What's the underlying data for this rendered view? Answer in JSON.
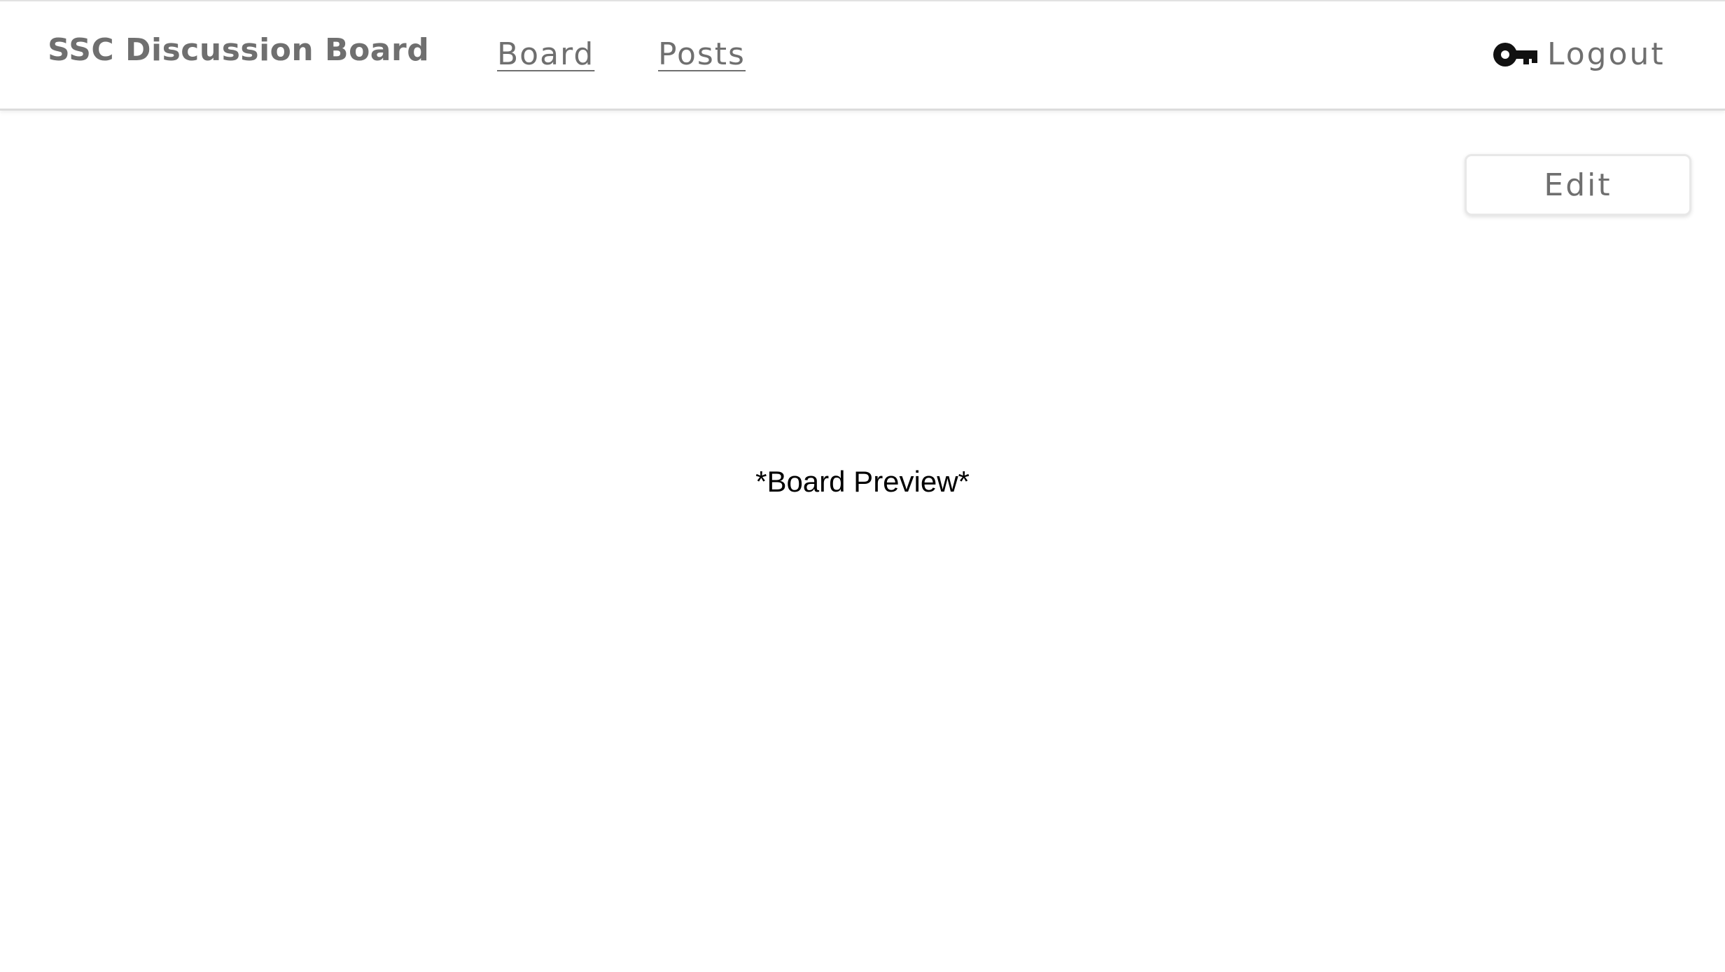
{
  "navbar": {
    "brand": "SSC Discussion Board",
    "links": [
      {
        "label": "Board"
      },
      {
        "label": "Posts"
      }
    ],
    "logout": {
      "icon": "key-icon",
      "label": "Logout"
    }
  },
  "toolbar": {
    "edit_label": "Edit"
  },
  "main": {
    "preview_text": "*Board Preview*"
  },
  "colors": {
    "text_gray": "#6f6f6f",
    "divider": "#dcdcdc",
    "preview_text": "#000000"
  }
}
